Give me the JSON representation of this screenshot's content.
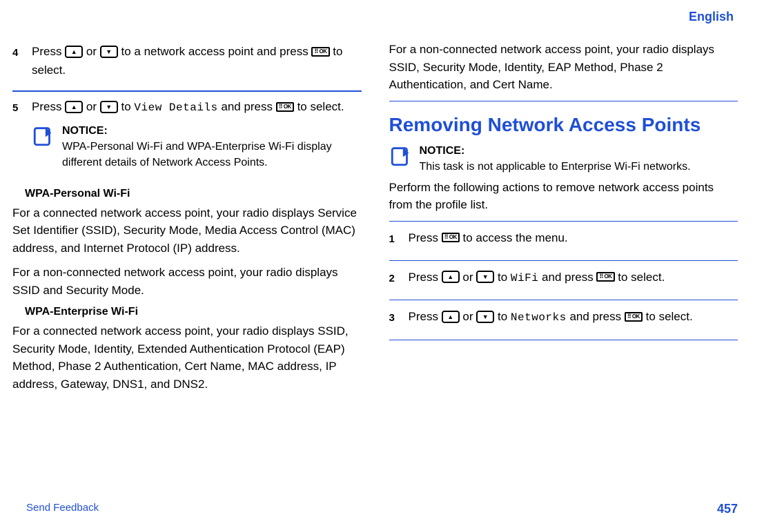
{
  "header": {
    "language": "English"
  },
  "left": {
    "step4": {
      "num": "4",
      "t1": "Press ",
      "t2": " or ",
      "t3": " to a network access point and press ",
      "t4": " to select."
    },
    "step5": {
      "num": "5",
      "t1": "Press ",
      "t2": " or ",
      "t3": " to ",
      "mono": "View Details",
      "t4": " and press ",
      "t5": " to select."
    },
    "notice": {
      "title": "NOTICE:",
      "body": "WPA-Personal Wi-Fi and WPA-Enterprise Wi-Fi display different details of Network Access Points."
    },
    "sub1": "WPA-Personal Wi-Fi",
    "p1": "For a connected network access point, your radio displays Service Set Identifier (SSID), Security Mode, Media Access Control (MAC) address, and Internet Protocol (IP) address.",
    "p2": "For a non-connected network access point, your radio displays SSID and Security Mode.",
    "sub2": "WPA-Enterprise Wi-Fi",
    "p3": "For a connected network access point, your radio displays SSID, Security Mode, Identity, Extended Authentication Protocol (EAP) Method, Phase 2 Authentication, Cert Name, MAC address, IP address, Gateway, DNS1, and DNS2."
  },
  "right": {
    "pTop": "For a non-connected network access point, your radio displays SSID, Security Mode, Identity, EAP Method, Phase 2 Authentication, and Cert Name.",
    "sectionTitle": "Removing Network Access Points",
    "notice": {
      "title": "NOTICE:",
      "body": "This task is not applicable to Enterprise Wi-Fi networks."
    },
    "pIntro": "Perform the following actions to remove network access points from the profile list.",
    "step1": {
      "num": "1",
      "t1": "Press ",
      "t2": " to access the menu."
    },
    "step2": {
      "num": "2",
      "t1": "Press ",
      "t2": " or ",
      "t3": " to ",
      "mono": "WiFi",
      "t4": " and press ",
      "t5": " to select."
    },
    "step3": {
      "num": "3",
      "t1": "Press ",
      "t2": " or ",
      "t3": " to ",
      "mono": "Networks",
      "t4": " and press ",
      "t5": " to select."
    }
  },
  "footer": {
    "feedback": "Send Feedback",
    "page": "457"
  },
  "icons": {
    "ok_label": "⠿ OK"
  }
}
